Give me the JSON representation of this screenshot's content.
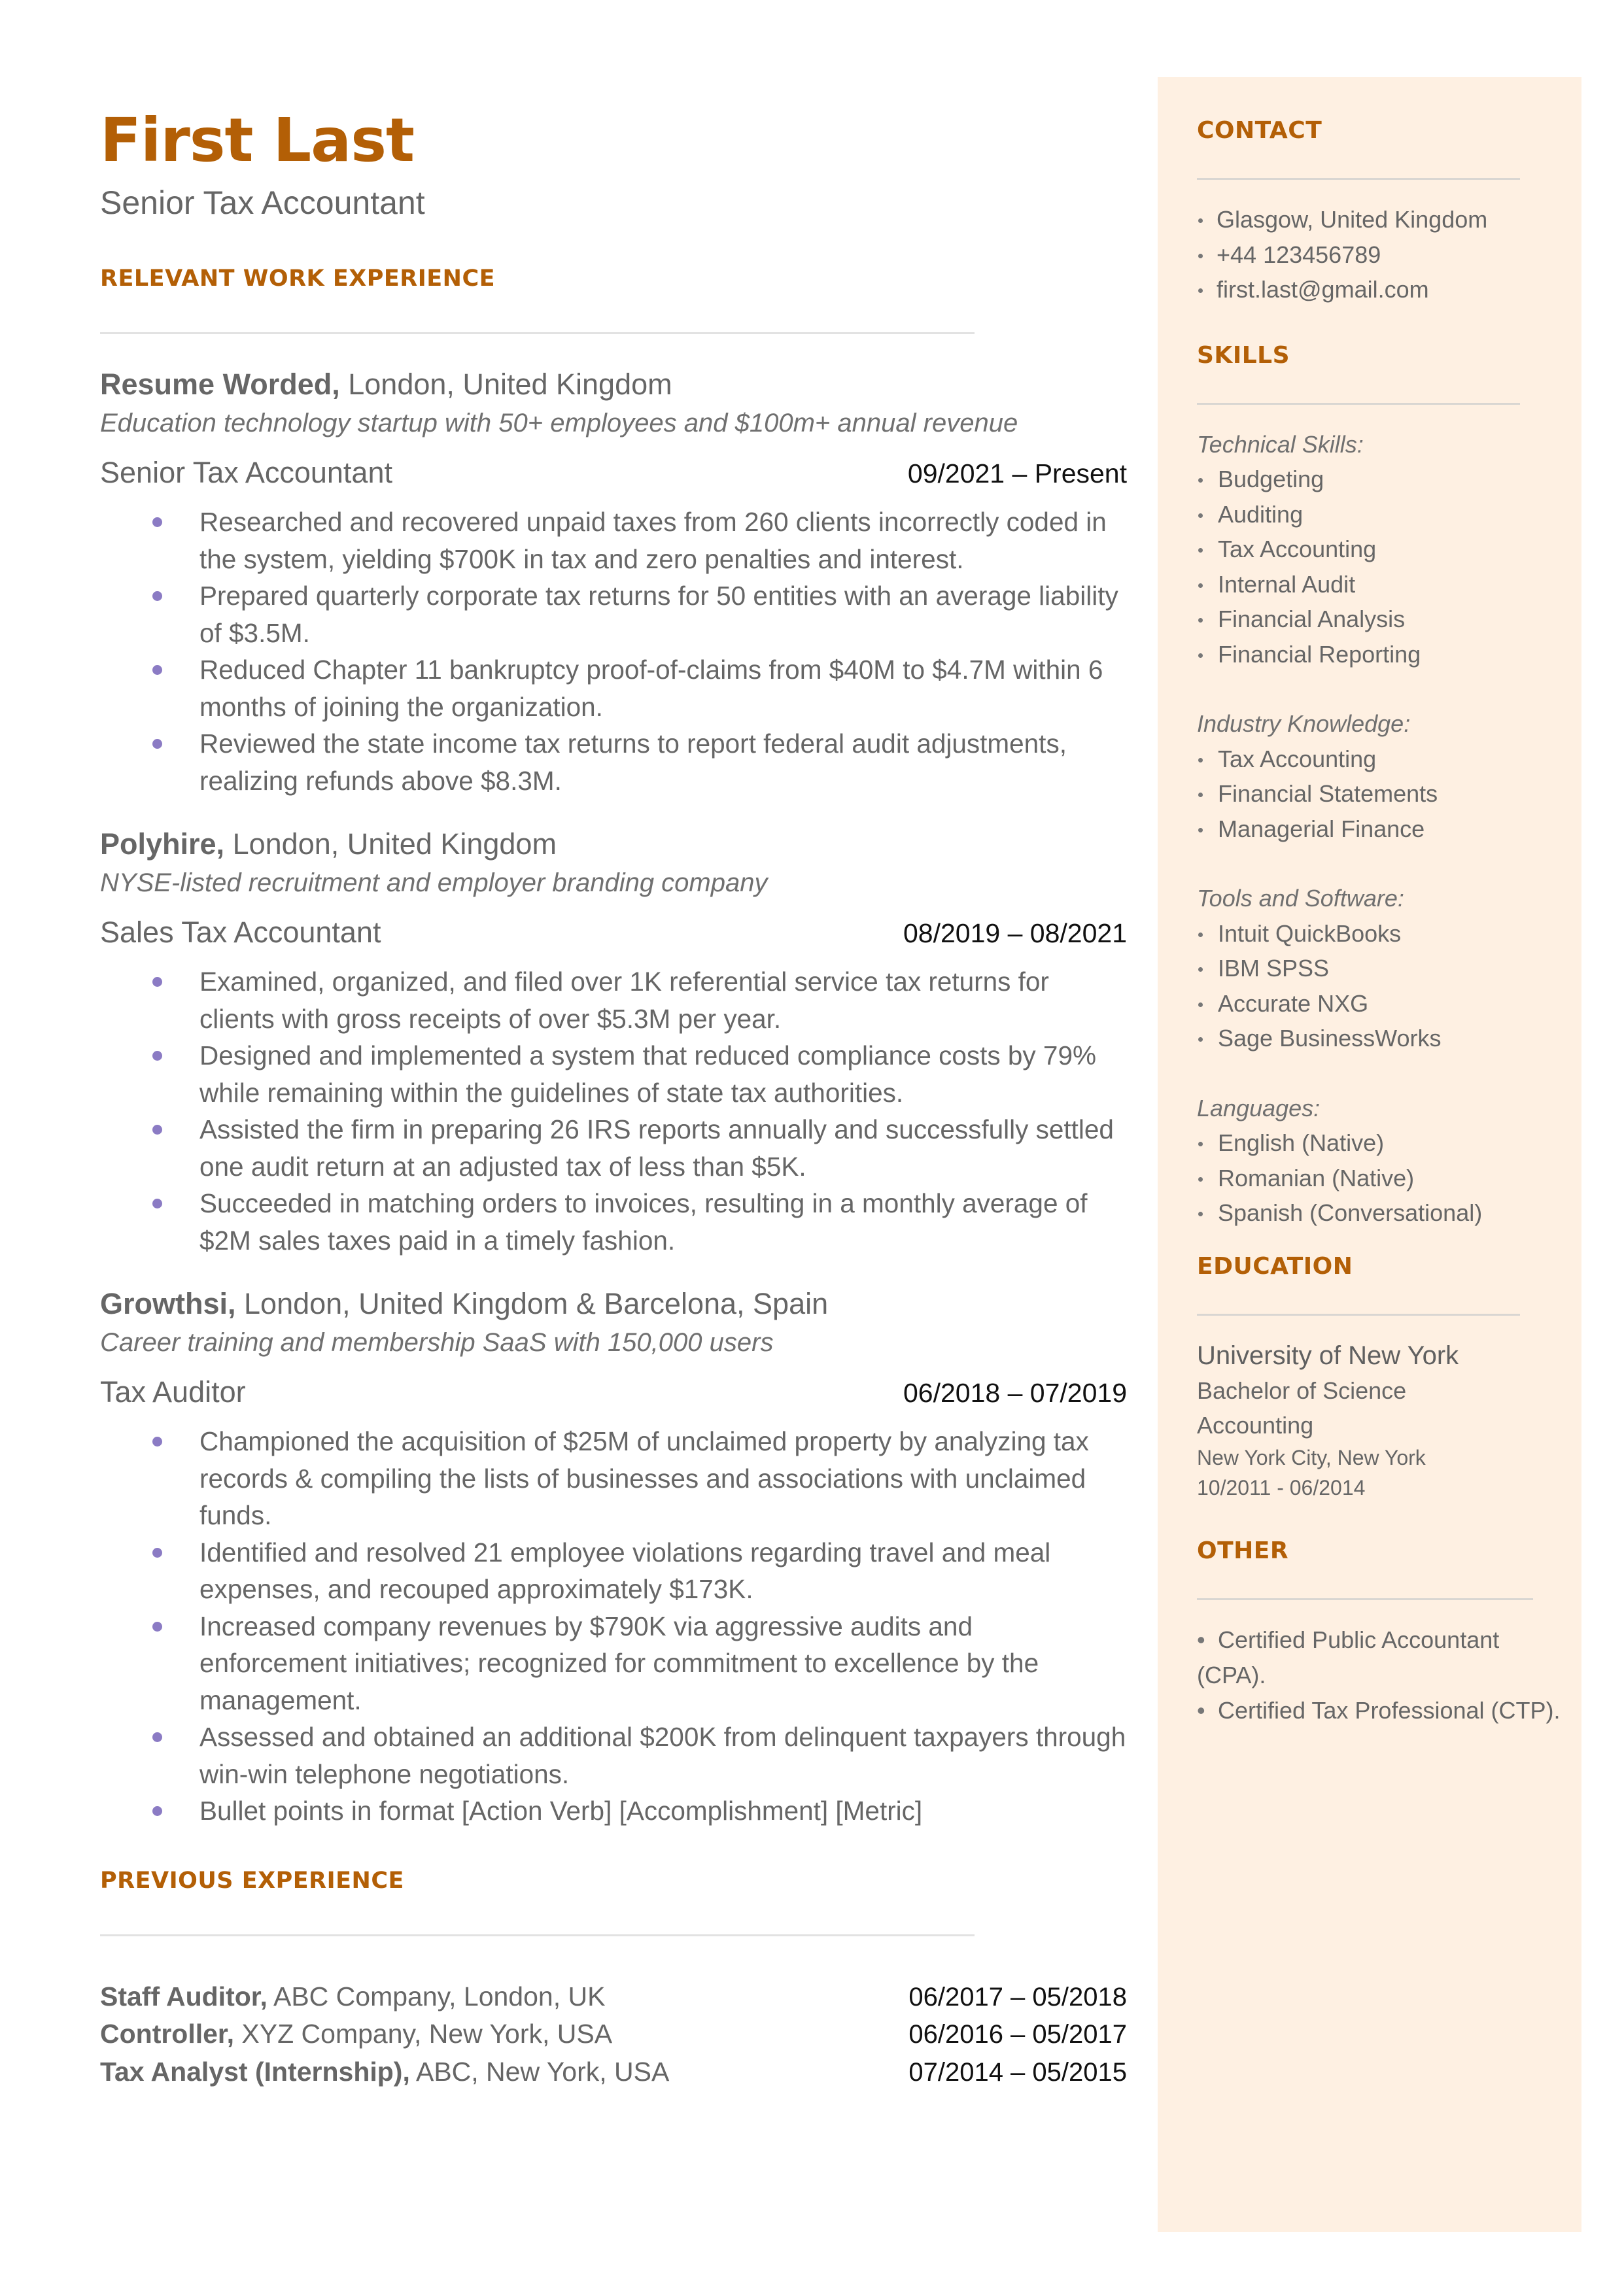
{
  "header": {
    "name": "First Last",
    "title": "Senior Tax Accountant"
  },
  "colors": {
    "accent": "#b35f06",
    "bullet": "#8b7bc4",
    "sidebar_bg": "#fef0e2",
    "text": "#666666"
  },
  "experience": {
    "heading": "RELEVANT WORK EXPERIENCE",
    "jobs": [
      {
        "company": "Resume Worded,",
        "location": " London, United Kingdom",
        "description": "Education technology startup with 50+ employees and $100m+ annual revenue",
        "role": "Senior Tax Accountant",
        "dates": "09/2021 – Present",
        "bullets": [
          "Researched and recovered unpaid taxes from 260 clients incorrectly coded in the system, yielding $700K in tax and zero penalties and interest.",
          "Prepared quarterly corporate tax returns for 50 entities with an average liability of $3.5M.",
          "Reduced Chapter 11 bankruptcy proof-of-claims from $40M to $4.7M within 6 months of joining the organization.",
          "Reviewed the state income tax returns to report federal audit adjustments, realizing refunds above $8.3M."
        ]
      },
      {
        "company": "Polyhire,",
        "location": " London, United Kingdom",
        "description": "NYSE-listed recruitment and employer branding company",
        "role": "Sales Tax Accountant",
        "dates": "08/2019 – 08/2021",
        "bullets": [
          "Examined, organized, and filed over 1K referential service tax returns for clients with gross receipts of over $5.3M per year.",
          "Designed and implemented a system that reduced compliance costs by 79% while remaining within the guidelines of state tax authorities.",
          "Assisted the firm in preparing 26 IRS reports annually and successfully settled one audit return at an adjusted tax of less than $5K.",
          "Succeeded in matching orders to invoices, resulting in a monthly average of $2M sales taxes paid in a timely fashion."
        ]
      },
      {
        "company": "Growthsi,",
        "location": " London, United Kingdom & Barcelona, Spain",
        "description": "Career training and membership SaaS with 150,000 users",
        "role": "Tax Auditor",
        "dates": "06/2018 – 07/2019",
        "bullets": [
          "Championed the acquisition of $25M of unclaimed property by analyzing tax records & compiling the lists of businesses and associations with unclaimed funds.",
          "Identified and resolved 21 employee violations regarding travel and meal expenses, and recouped approximately $173K.",
          "Increased company revenues by $790K via aggressive audits and enforcement initiatives; recognized for commitment to excellence by the management.",
          "Assessed and obtained an additional $200K from delinquent taxpayers through win-win telephone negotiations.",
          "Bullet points in format [Action Verb] [Accomplishment] [Metric]"
        ]
      }
    ]
  },
  "previous": {
    "heading": "PREVIOUS EXPERIENCE",
    "items": [
      {
        "role": "Staff Auditor,",
        "detail": " ABC Company, London, UK",
        "dates": "06/2017 – 05/2018"
      },
      {
        "role": "Controller,",
        "detail": " XYZ Company, New York, USA",
        "dates": "06/2016 – 05/2017"
      },
      {
        "role": "Tax Analyst (Internship),",
        "detail": " ABC, New York, USA",
        "dates": "07/2014 – 05/2015"
      }
    ]
  },
  "sidebar": {
    "contact": {
      "heading": "CONTACT",
      "items": [
        "Glasgow, United Kingdom",
        "+44 123456789",
        "first.last@gmail.com"
      ]
    },
    "skills": {
      "heading": "SKILLS",
      "groups": [
        {
          "label": "Technical Skills:",
          "items": [
            "Budgeting",
            "Auditing",
            "Tax Accounting",
            "Internal Audit",
            "Financial Analysis",
            "Financial Reporting"
          ]
        },
        {
          "label": "Industry Knowledge:",
          "items": [
            "Tax Accounting",
            "Financial Statements",
            "Managerial Finance"
          ]
        },
        {
          "label": "Tools and Software:",
          "items": [
            "Intuit QuickBooks",
            "IBM SPSS",
            "Accurate NXG",
            "Sage BusinessWorks"
          ]
        },
        {
          "label": "Languages:",
          "items": [
            "English (Native)",
            "Romanian (Native)",
            "Spanish (Conversational)"
          ]
        }
      ]
    },
    "education": {
      "heading": "EDUCATION",
      "school": "University of New York",
      "degree": "Bachelor of Science",
      "field": "Accounting",
      "location": "New York City, New York",
      "dates": "10/2011 - 06/2014"
    },
    "other": {
      "heading": "OTHER",
      "items": [
        "Certified Public Accountant (CPA).",
        "Certified Tax Professional (CTP)."
      ]
    }
  }
}
